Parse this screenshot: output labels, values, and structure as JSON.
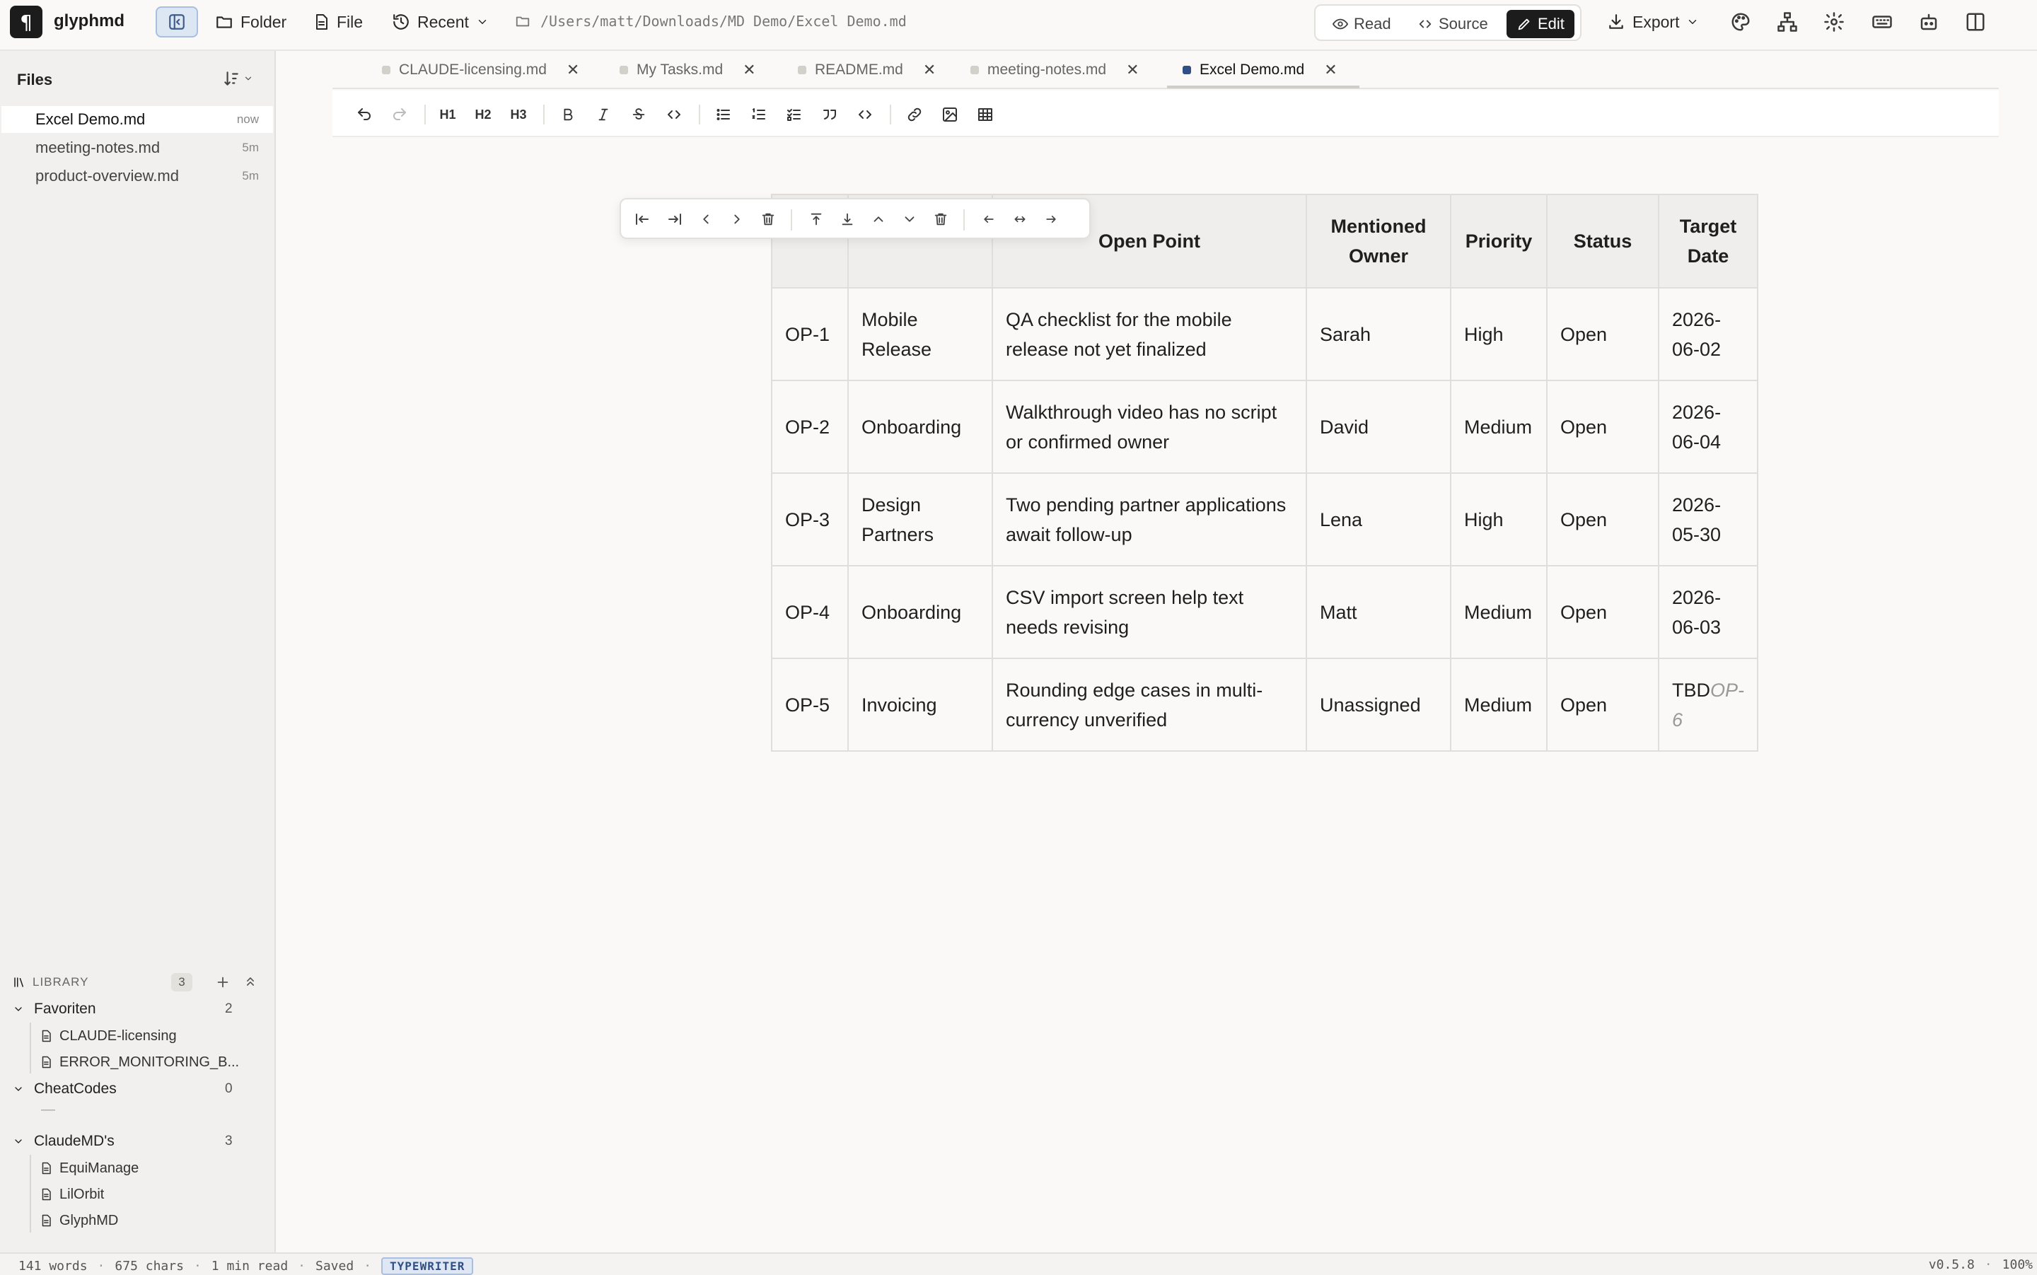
{
  "app": {
    "name": "glyphmd",
    "logo_glyph": "¶"
  },
  "topbar": {
    "folder_label": "Folder",
    "file_label": "File",
    "recent_label": "Recent",
    "path": "/Users/matt/Downloads/MD Demo/Excel Demo.md",
    "modes": {
      "read": "Read",
      "source": "Source",
      "edit": "Edit",
      "active": "edit"
    },
    "export_label": "Export",
    "tool_icons": [
      "palette-icon",
      "sitemap-icon",
      "gear-icon",
      "keyboard-icon",
      "robot-icon",
      "split-view-icon"
    ]
  },
  "sidebar": {
    "header": "Files",
    "files": [
      {
        "name": "Excel Demo.md",
        "time": "now",
        "active": true
      },
      {
        "name": "meeting-notes.md",
        "time": "5m",
        "active": false
      },
      {
        "name": "product-overview.md",
        "time": "5m",
        "active": false
      }
    ],
    "library": {
      "title": "LIBRARY",
      "count": "3",
      "groups": [
        {
          "name": "Favoriten",
          "count": "2",
          "items": [
            "CLAUDE-licensing",
            "ERROR_MONITORING_B..."
          ]
        },
        {
          "name": "CheatCodes",
          "count": "0",
          "items": [],
          "empty": "—"
        },
        {
          "name": "ClaudeMD's",
          "count": "3",
          "items": [
            "EquiManage",
            "LilOrbit",
            "GlyphMD"
          ]
        }
      ]
    }
  },
  "tabs": [
    {
      "label": "CLAUDE-licensing.md",
      "active": false
    },
    {
      "label": "My Tasks.md",
      "active": false
    },
    {
      "label": "README.md",
      "active": false
    },
    {
      "label": "meeting-notes.md",
      "active": false
    },
    {
      "label": "Excel Demo.md",
      "active": true
    }
  ],
  "format_toolbar": {
    "h1": "H1",
    "h2": "H2",
    "h3": "H3"
  },
  "table": {
    "headers": [
      "",
      "",
      "Open Point",
      "Mentioned Owner",
      "Priority",
      "Status",
      "Target Date"
    ],
    "rows": [
      [
        "OP-1",
        "Mobile Release",
        "QA checklist for the mobile release not yet finalized",
        "Sarah",
        "High",
        "Open",
        "2026-06-02"
      ],
      [
        "OP-2",
        "Onboarding",
        "Walkthrough video has no script or confirmed owner",
        "David",
        "Medium",
        "Open",
        "2026-06-04"
      ],
      [
        "OP-3",
        "Design Partners",
        "Two pending partner applications await follow-up",
        "Lena",
        "High",
        "Open",
        "2026-05-30"
      ],
      [
        "OP-4",
        "Onboarding",
        "CSV import screen help text needs revising",
        "Matt",
        "Medium",
        "Open",
        "2026-06-03"
      ],
      [
        "OP-5",
        "Invoicing",
        "Rounding edge cases in multi-currency unverified",
        "Unassigned",
        "Medium",
        "Open",
        "TBD"
      ]
    ],
    "ghost_suggestion": "OP-6"
  },
  "status": {
    "words": "141 words",
    "chars": "675 chars",
    "read_time": "1 min read",
    "saved": "Saved",
    "mode": "TYPEWRITER",
    "version": "v0.5.8",
    "zoom": "100%"
  }
}
